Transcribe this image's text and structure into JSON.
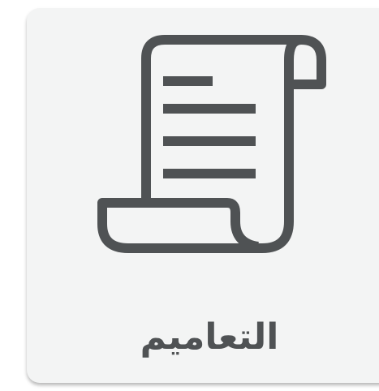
{
  "tile": {
    "label": "التعاميم",
    "icon": "scroll-document-icon",
    "background_color": "#f3f4f4",
    "icon_color": "#4f5254",
    "text_color": "#4f5254"
  }
}
